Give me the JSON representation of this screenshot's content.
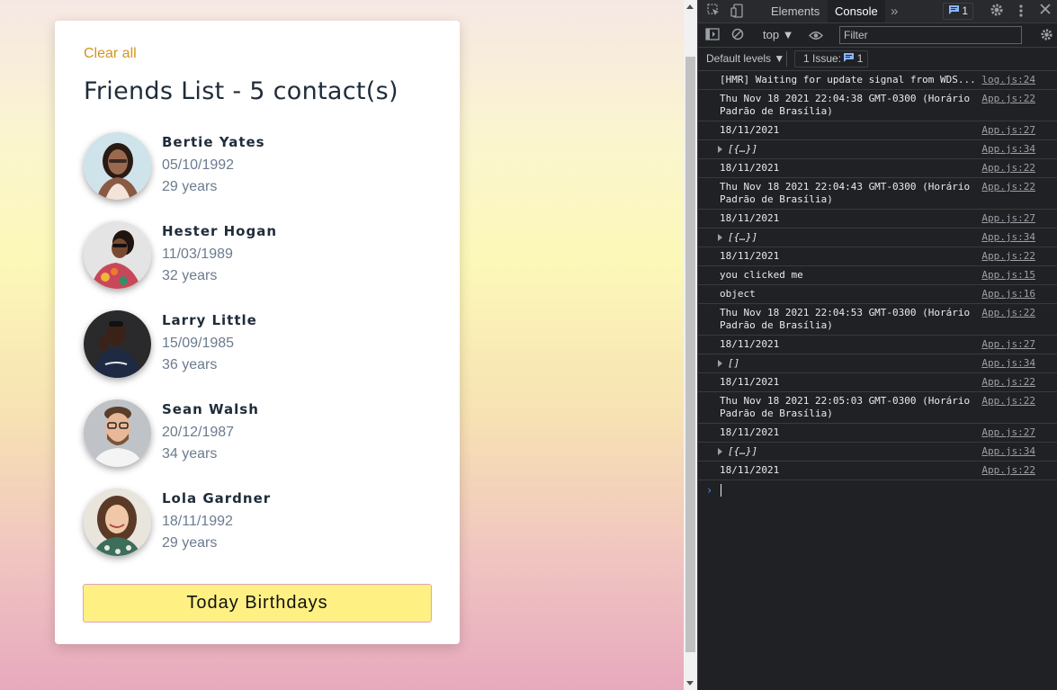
{
  "app": {
    "clear_all": "Clear all",
    "title": "Friends List - 5 contact(s)",
    "friends": [
      {
        "name": "Bertie Yates",
        "birthdate": "05/10/1992",
        "age": "29 years"
      },
      {
        "name": "Hester Hogan",
        "birthdate": "11/03/1989",
        "age": "32 years"
      },
      {
        "name": "Larry Little",
        "birthdate": "15/09/1985",
        "age": "36 years"
      },
      {
        "name": "Sean Walsh",
        "birthdate": "20/12/1987",
        "age": "34 years"
      },
      {
        "name": "Lola Gardner",
        "birthdate": "18/11/1992",
        "age": "29 years"
      }
    ],
    "button_label": "Today Birthdays"
  },
  "devtools": {
    "tabs": [
      {
        "label": "Elements",
        "active": false
      },
      {
        "label": "Console",
        "active": true
      }
    ],
    "more_tabs": "»",
    "issues_count": "1",
    "context": "top ▼",
    "filter_placeholder": "Filter",
    "default_levels": "Default levels ▼",
    "issue_button": "1 Issue:",
    "issue_button_count": "1",
    "log": [
      {
        "message": "[HMR] Waiting for update signal from WDS...",
        "source": "log.js:24",
        "expandable": false
      },
      {
        "message": "Thu Nov 18 2021 22:04:38 GMT-0300 (Horário Padrão de Brasília)",
        "source": "App.js:22",
        "expandable": false
      },
      {
        "message": "18/11/2021",
        "source": "App.js:27",
        "expandable": false
      },
      {
        "message": "[{…}]",
        "source": "App.js:34",
        "expandable": true
      },
      {
        "message": "18/11/2021",
        "source": "App.js:22",
        "expandable": false
      },
      {
        "message": "Thu Nov 18 2021 22:04:43 GMT-0300 (Horário Padrão de Brasília)",
        "source": "App.js:22",
        "expandable": false
      },
      {
        "message": "18/11/2021",
        "source": "App.js:27",
        "expandable": false
      },
      {
        "message": "[{…}]",
        "source": "App.js:34",
        "expandable": true
      },
      {
        "message": "18/11/2021",
        "source": "App.js:22",
        "expandable": false
      },
      {
        "message": "you clicked me",
        "source": "App.js:15",
        "expandable": false
      },
      {
        "message": "object",
        "source": "App.js:16",
        "expandable": false
      },
      {
        "message": "Thu Nov 18 2021 22:04:53 GMT-0300 (Horário Padrão de Brasília)",
        "source": "App.js:22",
        "expandable": false
      },
      {
        "message": "18/11/2021",
        "source": "App.js:27",
        "expandable": false
      },
      {
        "message": "[]",
        "source": "App.js:34",
        "expandable": true
      },
      {
        "message": "18/11/2021",
        "source": "App.js:22",
        "expandable": false
      },
      {
        "message": "Thu Nov 18 2021 22:05:03 GMT-0300 (Horário Padrão de Brasília)",
        "source": "App.js:22",
        "expandable": false
      },
      {
        "message": "18/11/2021",
        "source": "App.js:27",
        "expandable": false
      },
      {
        "message": "[{…}]",
        "source": "App.js:34",
        "expandable": true
      },
      {
        "message": "18/11/2021",
        "source": "App.js:22",
        "expandable": false
      }
    ],
    "prompt": "›",
    "colors": {
      "background": "#202124",
      "accent": "#8ab4f8"
    }
  }
}
